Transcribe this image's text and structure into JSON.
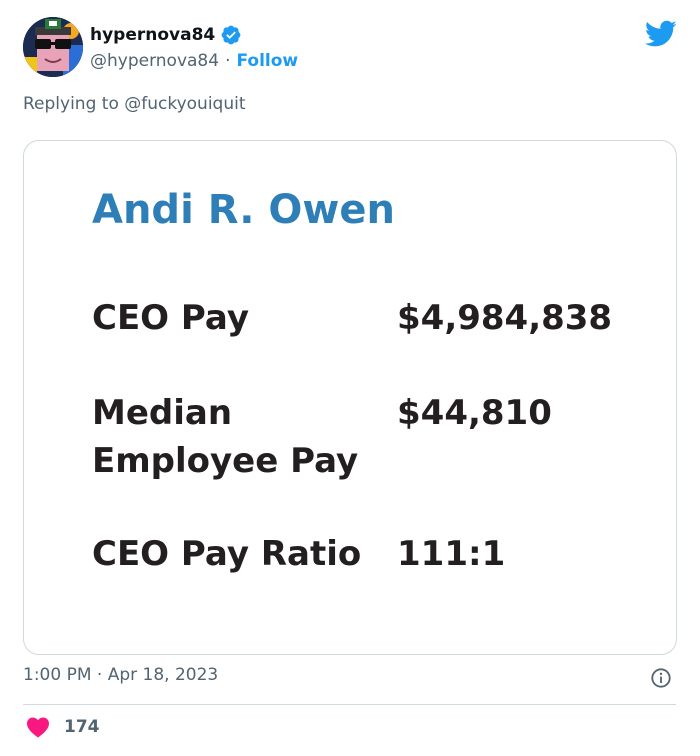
{
  "user": {
    "display_name": "hypernova84",
    "handle": "@hypernova84",
    "separator": "·",
    "follow_label": "Follow",
    "verified": true
  },
  "reply": {
    "prefix": "Replying to",
    "mention": "@fuckyouiquit"
  },
  "card": {
    "title": "Andi R. Owen",
    "rows": [
      {
        "label": "CEO Pay",
        "value": "$4,984,838"
      },
      {
        "label_line1": "Median",
        "label_line2": "Employee Pay",
        "value": "$44,810"
      },
      {
        "label": "CEO Pay Ratio",
        "value": "111:1"
      }
    ]
  },
  "footer": {
    "time": "1:00 PM",
    "separator": "·",
    "date": "Apr 18, 2023",
    "like_count": "174"
  },
  "icons": {
    "verified": "verified-badge-icon",
    "twitter": "twitter-bird-icon",
    "info": "info-icon",
    "heart": "heart-icon"
  },
  "colors": {
    "accent": "#1d9bf0",
    "title_blue": "#2e7fb8",
    "muted": "#536471",
    "heart": "#f91880"
  }
}
